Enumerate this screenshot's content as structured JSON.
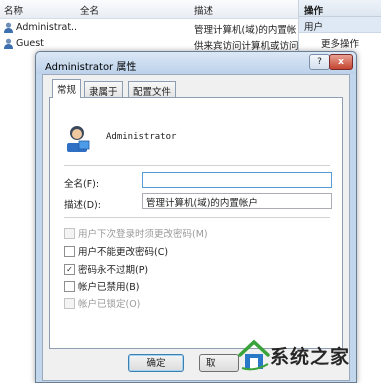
{
  "console": {
    "columns": {
      "name": "名称",
      "fullname": "全名",
      "description": "描述"
    },
    "rows": [
      {
        "name": "Administrat...",
        "fullname": "",
        "description": "管理计算机(域)的内置帐"
      },
      {
        "name": "Guest",
        "fullname": "",
        "description": "供来宾访问计算机或访问"
      }
    ],
    "actions": {
      "header": "操作",
      "section": "用户",
      "more": "更多操作"
    }
  },
  "dialog": {
    "title": "Administrator 属性",
    "help": "?",
    "close": "x",
    "tabs": [
      "常规",
      "隶属于",
      "配置文件"
    ],
    "username": "Administrator",
    "fullname_label": "全名(F):",
    "fullname_value": "",
    "description_label": "描述(D):",
    "description_value": "管理计算机(域)的内置帐户",
    "checkboxes": [
      {
        "label": "用户下次登录时须更改密码(M)",
        "checked": false,
        "disabled": true
      },
      {
        "label": "用户不能更改密码(C)",
        "checked": false,
        "disabled": false
      },
      {
        "label": "密码永不过期(P)",
        "checked": true,
        "disabled": false
      },
      {
        "label": "帐户已禁用(B)",
        "checked": false,
        "disabled": false
      },
      {
        "label": "帐户已锁定(O)",
        "checked": false,
        "disabled": true
      }
    ],
    "buttons": {
      "ok": "确定",
      "cancel": "取"
    }
  },
  "watermark": {
    "text": "系统之家"
  },
  "colors": {
    "accent": "#3c7fb1",
    "dialog_frame": "#c3d7ec",
    "watermark_green": "#3aa23a",
    "watermark_blue": "#2a78c8"
  }
}
